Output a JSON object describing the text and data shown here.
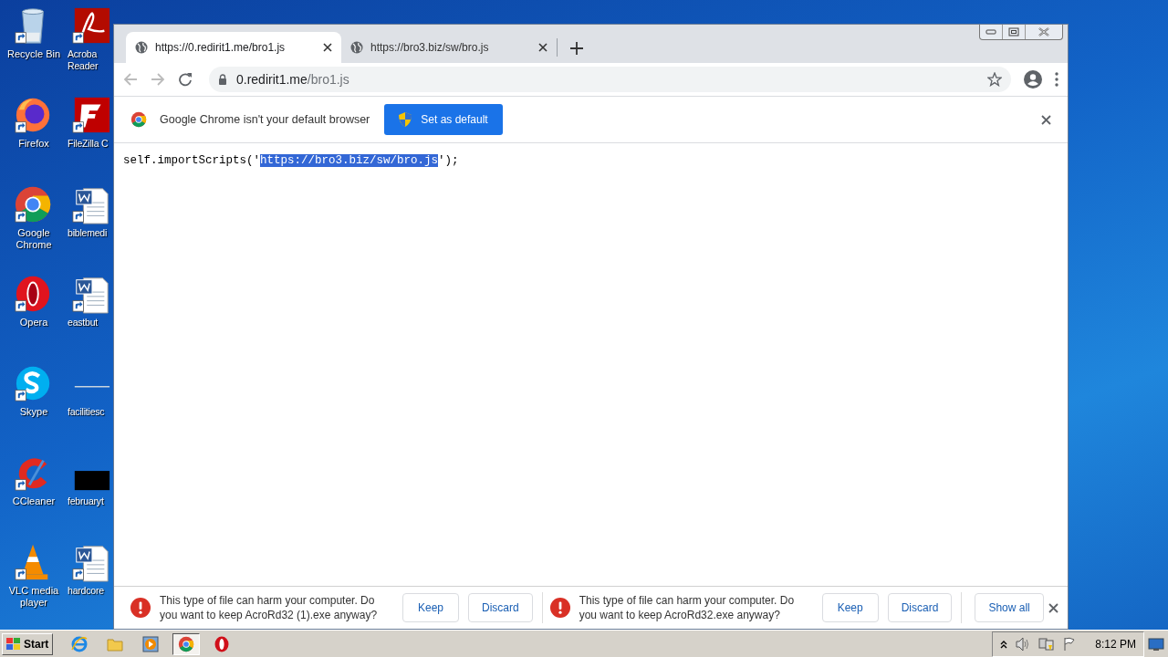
{
  "desktop": {
    "icons": [
      {
        "label": "Recycle Bin",
        "kind": "recycle"
      },
      {
        "label": "Acroba Reader",
        "kind": "pdf"
      },
      {
        "label": "Firefox",
        "kind": "firefox"
      },
      {
        "label": "FileZilla C",
        "kind": "filezilla"
      },
      {
        "label": "Google Chrome",
        "kind": "chrome"
      },
      {
        "label": "biblemedi",
        "kind": "word"
      },
      {
        "label": "Opera",
        "kind": "opera"
      },
      {
        "label": "eastbut",
        "kind": "word"
      },
      {
        "label": "Skype",
        "kind": "skype"
      },
      {
        "label": "facilitiesc",
        "kind": "blank"
      },
      {
        "label": "CCleaner",
        "kind": "ccleaner"
      },
      {
        "label": "februaryt",
        "kind": "black"
      },
      {
        "label": "VLC media player",
        "kind": "vlc"
      },
      {
        "label": "hardcore",
        "kind": "word"
      }
    ]
  },
  "browser": {
    "tabs": [
      {
        "title": "https://0.redirit1.me/bro1.js",
        "selected": true
      },
      {
        "title": "https://bro3.biz/sw/bro.js",
        "selected": false
      }
    ],
    "address": {
      "host": "0.redirit1.me",
      "path": "/bro1.js"
    },
    "infobar": {
      "message": "Google Chrome isn't your default browser",
      "button": "Set as default"
    },
    "page": {
      "code_before": "self.importScripts('",
      "selection": "https://bro3.biz/sw/bro.js",
      "code_after": "');"
    },
    "downloads": [
      {
        "message": "This type of file can harm your computer. Do you want to keep AcroRd32 (1).exe anyway?",
        "buttons": [
          "Keep",
          "Discard"
        ]
      },
      {
        "message": "This type of file can harm your computer. Do you want to keep AcroRd32.exe anyway?",
        "buttons": [
          "Keep",
          "Discard"
        ]
      }
    ],
    "show_all": "Show all"
  },
  "taskbar": {
    "start": "Start",
    "apps": [
      {
        "kind": "ie",
        "selected": false
      },
      {
        "kind": "folder",
        "selected": false
      },
      {
        "kind": "media",
        "selected": false
      },
      {
        "kind": "chrome",
        "selected": true
      },
      {
        "kind": "opera",
        "selected": false
      }
    ],
    "time": "8:12 PM"
  }
}
